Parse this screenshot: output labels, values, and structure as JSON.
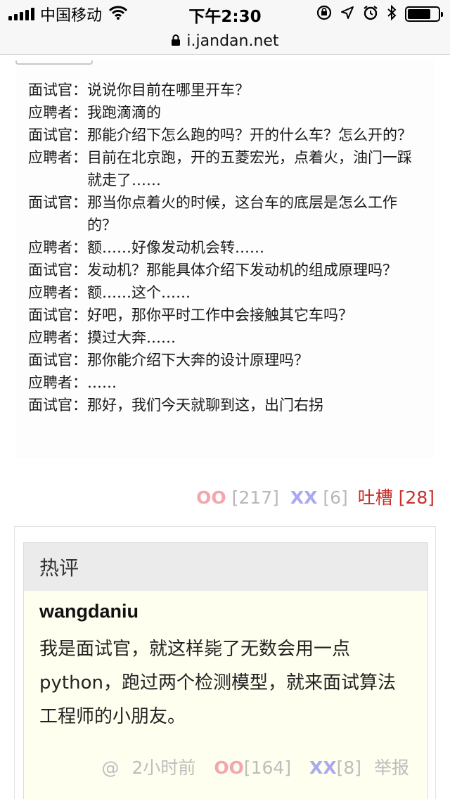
{
  "status_bar": {
    "carrier": "中国移动",
    "time": "下午2:30",
    "battery_level": 0.75,
    "icons": [
      "signal-bars-icon",
      "wifi-icon",
      "orientation-lock-icon",
      "location-arrow-icon",
      "alarm-icon",
      "bluetooth-icon",
      "battery-icon"
    ]
  },
  "browser": {
    "url": "i.jandan.net",
    "lock_icon": "lock-icon"
  },
  "post": {
    "dialogue": [
      {
        "speaker": "面试官：",
        "text": "说说你目前在哪里开车？"
      },
      {
        "speaker": "应聘者：",
        "text": "我跑滴滴的"
      },
      {
        "speaker": "面试官：",
        "text": "那能介绍下怎么跑的吗？开的什么车？怎么开的？"
      },
      {
        "speaker": "应聘者：",
        "text": "目前在北京跑，开的五菱宏光，点着火，油门一踩就走了……"
      },
      {
        "speaker": "面试官：",
        "text": "那当你点着火的时候，这台车的底层是怎么工作的？"
      },
      {
        "speaker": "应聘者：",
        "text": "额……好像发动机会转……"
      },
      {
        "speaker": "面试官：",
        "text": "发动机？那能具体介绍下发动机的组成原理吗？"
      },
      {
        "speaker": "应聘者：",
        "text": "额……这个……"
      },
      {
        "speaker": "面试官：",
        "text": "好吧，那你平时工作中会接触其它车吗？"
      },
      {
        "speaker": "应聘者：",
        "text": "摸过大奔……"
      },
      {
        "speaker": "面试官：",
        "text": "那你能介绍下大奔的设计原理吗？"
      },
      {
        "speaker": "应聘者：",
        "text": "……"
      },
      {
        "speaker": "面试官：",
        "text": "那好，我们今天就聊到这，出门右拐"
      }
    ],
    "votes": {
      "oo_label": "OO",
      "oo_count": "[217]",
      "xx_label": "XX",
      "xx_count": "[6]",
      "tucao_label": "吐槽",
      "tucao_count": "[28]"
    }
  },
  "hot_comments": {
    "header": "热评",
    "items": [
      {
        "author": "wangdaniu",
        "text": "我是面试官，就这样毙了无数会用一点python，跑过两个检测模型，就来面试算法工程师的小朋友。",
        "at": "@",
        "time": "2小时前",
        "oo_label": "OO",
        "oo_count": "[164]",
        "xx_label": "XX",
        "xx_count": "[8]",
        "report": "举报"
      }
    ]
  },
  "colors": {
    "oo": "#f4a6ad",
    "xx": "#a9a9ee",
    "tucao": "#c6312b",
    "comment_bg": "#fffff0",
    "header_bg": "#ebebeb"
  }
}
